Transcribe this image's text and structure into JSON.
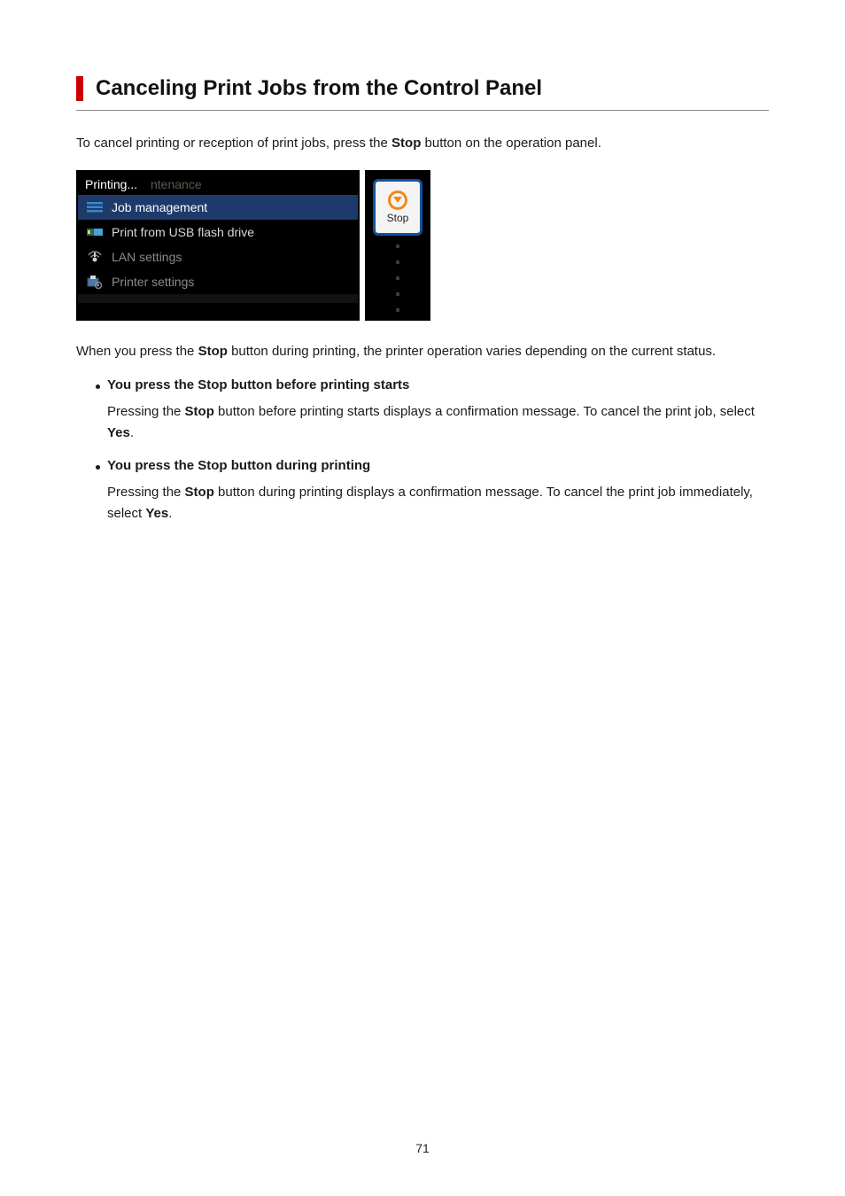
{
  "title": "Canceling Print Jobs from the Control Panel",
  "intro": {
    "pre": "To cancel printing or reception of print jobs, press the ",
    "bold": "Stop",
    "post": " button on the operation panel."
  },
  "panel": {
    "status_front": "Printing...",
    "status_ghost": "ntenance",
    "menu_items": [
      {
        "icon": "list",
        "label": "Job management",
        "active": true
      },
      {
        "icon": "usb",
        "label": "Print from USB flash drive",
        "active": false
      },
      {
        "icon": "lan",
        "label": "LAN settings",
        "active": false,
        "dim": true
      },
      {
        "icon": "printer",
        "label": "Printer settings",
        "active": false,
        "dim": true
      }
    ],
    "stop_label": "Stop"
  },
  "paragraph2": {
    "pre": "When you press the ",
    "bold": "Stop",
    "post": " button during printing, the printer operation varies depending on the current status."
  },
  "bullets": [
    {
      "heading": "You press the Stop button before printing starts",
      "body_pre": "Pressing the ",
      "body_b1": "Stop",
      "body_mid": " button before printing starts displays a confirmation message. To cancel the print job, select ",
      "body_b2": "Yes",
      "body_post": "."
    },
    {
      "heading": "You press the Stop button during printing",
      "body_pre": "Pressing the ",
      "body_b1": "Stop",
      "body_mid": " button during printing displays a confirmation message. To cancel the print job immediately, select ",
      "body_b2": "Yes",
      "body_post": "."
    }
  ],
  "page_number": "71"
}
